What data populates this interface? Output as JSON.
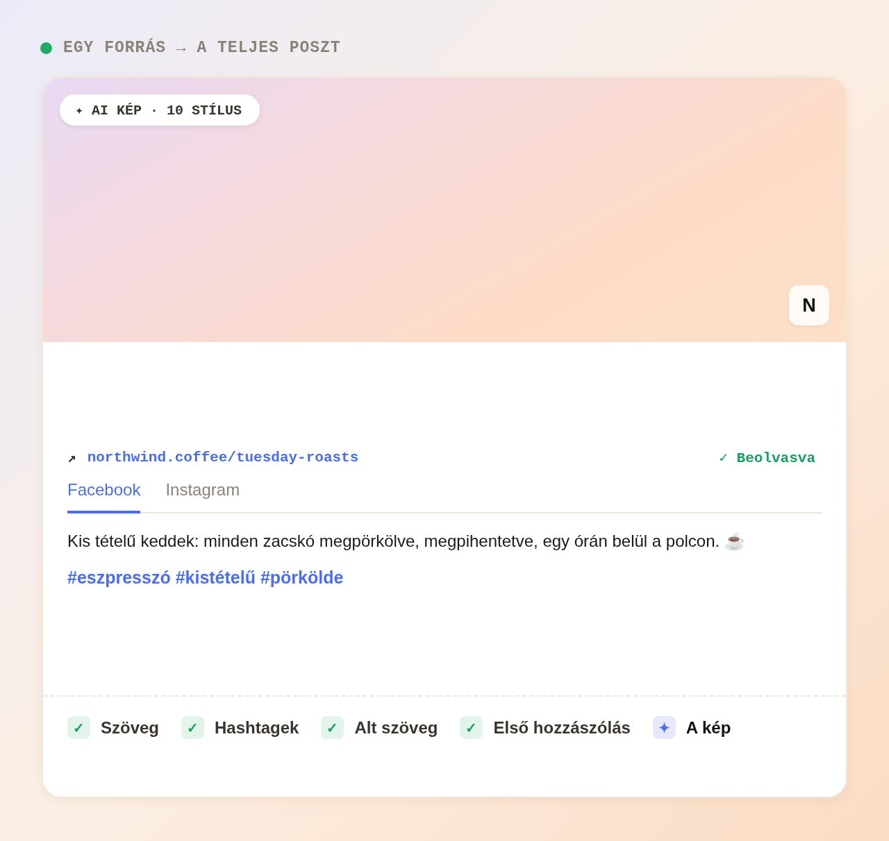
{
  "header": {
    "title": "EGY FORRÁS → A TELJES POSZT"
  },
  "card": {
    "image": {
      "badge": "✦ AI KÉP · 10 STÍLUS",
      "brand_mark": "N"
    },
    "source": {
      "arrow": "↗",
      "url": "northwind.coffee/tuesday-roasts",
      "status": "✓ Beolvasva"
    },
    "tabs": [
      {
        "label": "Facebook",
        "selected": true
      },
      {
        "label": "Instagram",
        "selected": false
      }
    ],
    "post": {
      "text": "Kis tételű keddek: minden zacskó megpörkölve, megpihentetve, egy órán belül a polcon. ☕",
      "hashtags": "#eszpresszó #kistételű #pörkölde"
    },
    "checklist": [
      {
        "kind": "done",
        "icon": "✓",
        "label": "Szöveg"
      },
      {
        "kind": "done",
        "icon": "✓",
        "label": "Hashtagek"
      },
      {
        "kind": "done",
        "icon": "✓",
        "label": "Alt szöveg"
      },
      {
        "kind": "done",
        "icon": "✓",
        "label": "Első hozzászólás"
      },
      {
        "kind": "ai",
        "icon": "✦",
        "label": "A kép"
      }
    ]
  }
}
